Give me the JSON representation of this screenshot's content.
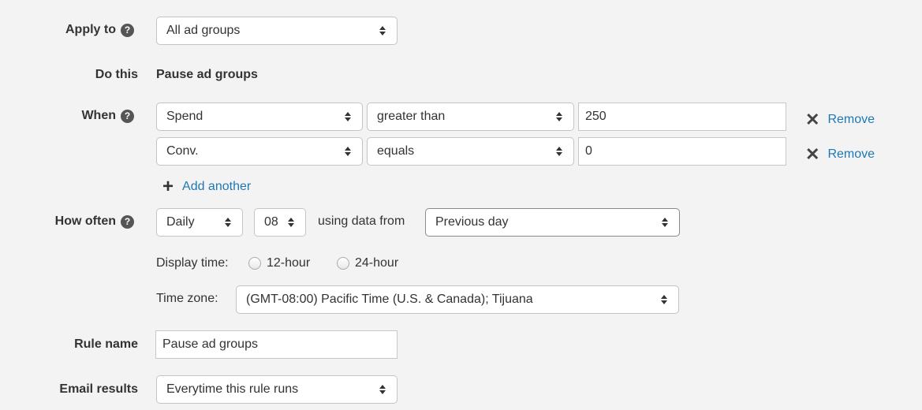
{
  "apply_to": {
    "label": "Apply to",
    "help_icon": "question-circle-icon",
    "value": "All ad groups"
  },
  "do_this": {
    "label": "Do this",
    "value": "Pause ad groups"
  },
  "when": {
    "label": "When",
    "help_icon": "question-circle-icon",
    "conditions": [
      {
        "metric": "Spend",
        "operator": "greater than",
        "value": "250",
        "remove_label": "Remove"
      },
      {
        "metric": "Conv.",
        "operator": "equals",
        "value": "0",
        "remove_label": "Remove"
      }
    ],
    "add_another_label": "Add another",
    "remove_icon": "x-icon",
    "add_icon": "plus-icon"
  },
  "how_often": {
    "label": "How often",
    "help_icon": "question-circle-icon",
    "frequency": "Daily",
    "hour": "08",
    "using_data_from_label": "using data from",
    "data_range": "Previous day",
    "display_time_label": "Display time:",
    "display_time_options": [
      "12-hour",
      "24-hour"
    ],
    "time_zone_label": "Time zone:",
    "time_zone": "(GMT-08:00) Pacific Time (U.S. & Canada); Tijuana"
  },
  "rule_name": {
    "label": "Rule name",
    "value": "Pause ad groups"
  },
  "email_results": {
    "label": "Email results",
    "value": "Everytime this rule runs"
  },
  "colors": {
    "background": "#f3f3f3",
    "link": "#1f78b4",
    "text": "#333333"
  }
}
